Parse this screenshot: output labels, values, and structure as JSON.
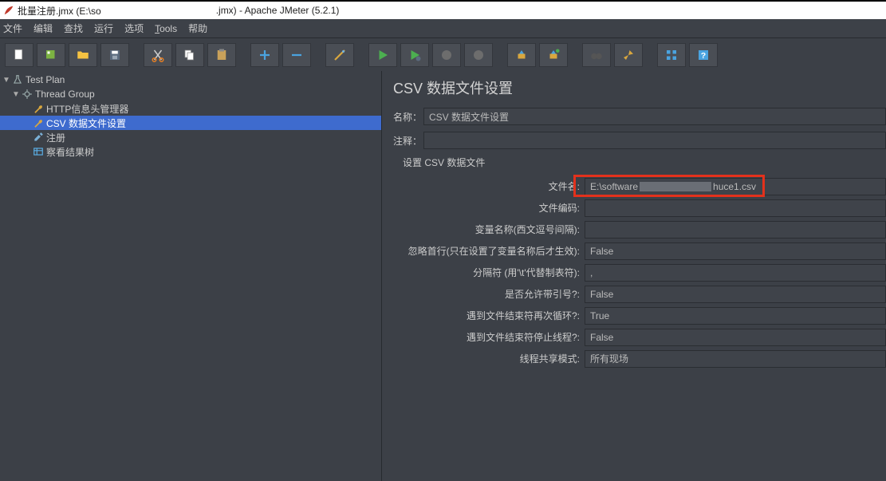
{
  "title": {
    "prefix": "批量注册.jmx (E:\\so",
    "suffix": ".jmx) - Apache JMeter (5.2.1)"
  },
  "menu": [
    "文件",
    "编辑",
    "查找",
    "运行",
    "选项",
    "Tools",
    "帮助"
  ],
  "toolbar_icons": [
    "new-file",
    "templates",
    "open",
    "save",
    "",
    "cut",
    "copy",
    "paste",
    "",
    "plus",
    "minus",
    "",
    "wand",
    "",
    "play",
    "play-current",
    "stop",
    "stop-all",
    "",
    "clear",
    "sweep",
    "",
    "binoculars",
    "broom",
    "",
    "tree-toggle",
    "help"
  ],
  "tree": {
    "root": "Test Plan",
    "group": "Thread Group",
    "items": [
      {
        "icon": "wrench",
        "label": "HTTP信息头管理器"
      },
      {
        "icon": "wrench",
        "label": "CSV 数据文件设置",
        "selected": true
      },
      {
        "icon": "dropper",
        "label": "注册"
      },
      {
        "icon": "table",
        "label": "察看结果树"
      }
    ]
  },
  "form": {
    "title": "CSV 数据文件设置",
    "name_label": "名称：",
    "name_value": "CSV 数据文件设置",
    "comment_label": "注释：",
    "comment_value": "",
    "group_label": "设置 CSV 数据文件",
    "rows": [
      {
        "label": "文件名:",
        "value_prefix": "E:\\software",
        "value_suffix": "huce1.csv",
        "highlight": true,
        "redact": true
      },
      {
        "label": "文件编码:",
        "value": ""
      },
      {
        "label": "变量名称(西文逗号间隔):",
        "value": ""
      },
      {
        "label": "忽略首行(只在设置了变量名称后才生效):",
        "value": "False"
      },
      {
        "label": "分隔符 (用'\\t'代替制表符):",
        "value": ","
      },
      {
        "label": "是否允许带引号?:",
        "value": "False"
      },
      {
        "label": "遇到文件结束符再次循环?:",
        "value": "True"
      },
      {
        "label": "遇到文件结束符停止线程?:",
        "value": "False"
      },
      {
        "label": "线程共享模式:",
        "value": "所有现场"
      }
    ]
  }
}
